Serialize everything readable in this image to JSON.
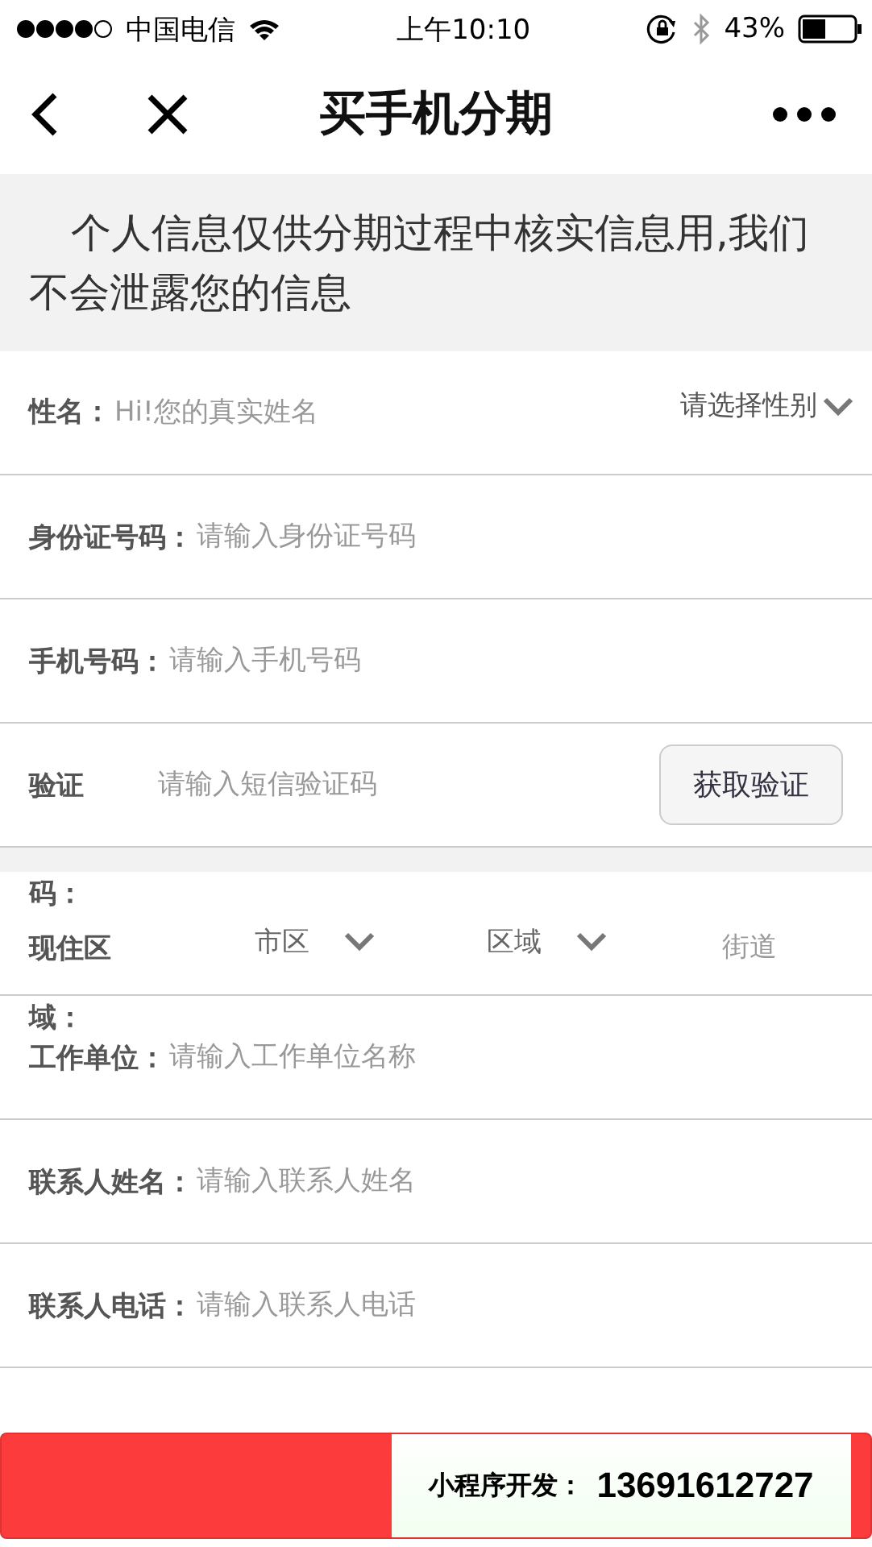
{
  "status_bar": {
    "carrier": "中国电信",
    "time": "上午10:10",
    "battery": "43%"
  },
  "nav": {
    "title": "买手机分期"
  },
  "notice": "个人信息仅供分期过程中核实信息用,我们不会泄露您的信息",
  "rows": [
    {
      "kind": "gender",
      "label": "性名：",
      "placeholder": "Hi!您的真实姓名",
      "select": "请选择性别"
    },
    {
      "kind": "input",
      "label": "身份证号码：",
      "placeholder": "请输入身份证号码"
    },
    {
      "kind": "input",
      "label": "手机号码：",
      "placeholder": "请输入手机号码"
    },
    {
      "kind": "verify",
      "label": "验证",
      "placeholder": "请输入短信验证码",
      "button": "获取验证"
    },
    {
      "kind": "address",
      "top_text": "码：",
      "label": "现住区",
      "city": "市区",
      "district": "区域",
      "street_placeholder": "街道"
    },
    {
      "kind": "input",
      "top_text": "域：",
      "label": "工作单位：",
      "placeholder": "请输入工作单位名称"
    },
    {
      "kind": "input",
      "label": "联系人姓名：",
      "placeholder": "请输入联系人姓名"
    },
    {
      "kind": "input",
      "label": "联系人电话：",
      "placeholder": "请输入联系人电话"
    }
  ],
  "promo": {
    "label": "小程序开发：",
    "phone": "13691612727"
  }
}
